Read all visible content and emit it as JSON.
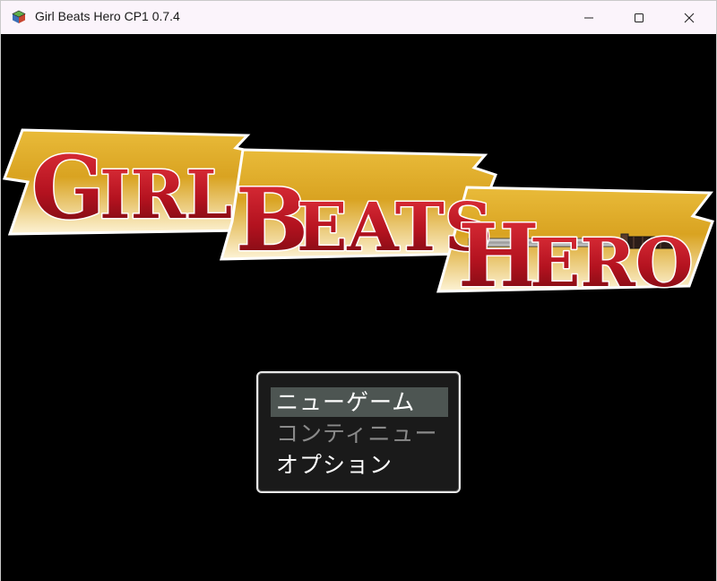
{
  "window": {
    "title": "Girl Beats Hero CP1 0.7.4",
    "app_icon": "cube-app-icon",
    "controls": {
      "minimize": "minimize-icon",
      "maximize": "maximize-icon",
      "close": "close-icon"
    }
  },
  "logo": {
    "word1_initial": "G",
    "word1_rest": "IRL",
    "word2_initial": "B",
    "word2_rest": "EATS",
    "word3_initial": "H",
    "word3_rest": "ERO",
    "text_color": "#b3121f",
    "banner_color": "#d9a321"
  },
  "menu": {
    "items": [
      {
        "label": "ニューゲーム",
        "state": "selected"
      },
      {
        "label": "コンティニュー",
        "state": "disabled"
      },
      {
        "label": "オプション",
        "state": "enabled"
      }
    ]
  }
}
